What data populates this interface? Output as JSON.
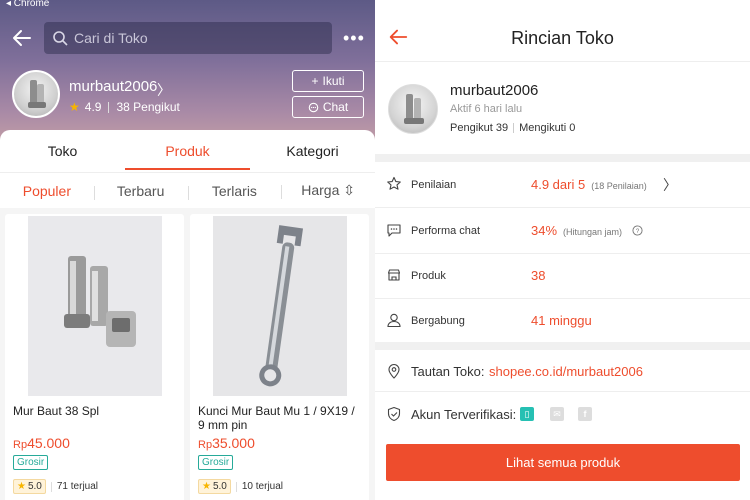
{
  "status_bar": {
    "app": "◂ Chrome"
  },
  "shop_page": {
    "search_placeholder": "Cari di Toko",
    "shop_name": "murbaut2006",
    "rating": "4.9",
    "followers": "38 Pengikut",
    "follow_label": "Ikuti",
    "chat_label": "Chat",
    "tabs": [
      {
        "label": "Toko",
        "active": false
      },
      {
        "label": "Produk",
        "active": true
      },
      {
        "label": "Kategori",
        "active": false
      }
    ],
    "sort": [
      {
        "label": "Populer",
        "active": true
      },
      {
        "label": "Terbaru",
        "active": false
      },
      {
        "label": "Terlaris",
        "active": false
      },
      {
        "label": "Harga ⇳",
        "active": false
      }
    ],
    "products": [
      {
        "title": "Mur Baut 38 Spl",
        "currency": "Rp",
        "price": "45.000",
        "tag": "Grosir",
        "rating": "5.0",
        "sold": "71 terjual"
      },
      {
        "title": "Kunci Mur Baut Mu 1 / 9X19 / 9 mm pin",
        "currency": "Rp",
        "price": "35.000",
        "tag": "Grosir",
        "rating": "5.0",
        "sold": "10 terjual"
      }
    ]
  },
  "detail_page": {
    "title": "Rincian Toko",
    "shop_name": "murbaut2006",
    "last_active": "Aktif 6 hari lalu",
    "followers": "Pengikut 39",
    "following": "Mengikuti 0",
    "rows": {
      "rating": {
        "label": "Penilaian",
        "value": "4.9 dari 5",
        "note": "(18 Penilaian)"
      },
      "chat": {
        "label": "Performa chat",
        "value": "34%",
        "note": "(Hitungan jam)"
      },
      "products": {
        "label": "Produk",
        "value": "38"
      },
      "joined": {
        "label": "Bergabung",
        "value": "41 minggu"
      }
    },
    "link_label": "Tautan Toko:",
    "link_url": "shopee.co.id/murbaut2006",
    "verified_label": "Akun Terverifikasi:",
    "cta": "Lihat semua produk"
  },
  "colors": {
    "accent": "#ee4d2d",
    "teal": "#26aa99",
    "star": "#f7b500"
  }
}
